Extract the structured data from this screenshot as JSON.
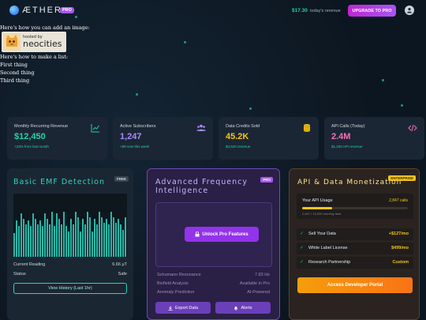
{
  "brand": {
    "name": "ÆTHER",
    "badge": "PRO"
  },
  "header": {
    "revenue_amount": "$17.30",
    "revenue_label": "today's revenue",
    "upgrade_label": "UPGRADE TO PRO"
  },
  "injected": {
    "image_intro": "Here's how you can add an image:",
    "neocities_small": "hosted by",
    "neocities_big": "neocities",
    "list_intro": "Here's how to make a list:",
    "items": [
      "First thing",
      "Second thing",
      "Third thing"
    ]
  },
  "stats": [
    {
      "title": "Monthly Recurring Revenue",
      "value": "$12,450",
      "sub": "+23% from last month",
      "icon": "chart-icon",
      "color": "#22d3a6"
    },
    {
      "title": "Active Subscribers",
      "value": "1,247",
      "sub": "+89 new this week",
      "icon": "users-icon",
      "color": "#a78bfa"
    },
    {
      "title": "Data Credits Sold",
      "value": "45.2K",
      "sub": "$4,520 revenue",
      "icon": "database-icon",
      "color": "#f5c518"
    },
    {
      "title": "API Calls (Today)",
      "value": "2.4M",
      "sub": "$1,200 API revenue",
      "icon": "code-icon",
      "color": "#f472b6"
    }
  ],
  "emf": {
    "title": "Basic EMF Detection",
    "tag": "FREE",
    "current_label": "Current Reading",
    "current_value": "6.66 μT",
    "status_label": "Status",
    "status_value": "Safe",
    "history_label": "View History (Last 1hr)"
  },
  "freq": {
    "title": "Advanced Frequency Intelligence",
    "tag": "PRO",
    "unlock_label": "Unlock Pro Features",
    "rows": [
      {
        "label": "Schumann Resonance",
        "value": "7.83 Hz"
      },
      {
        "label": "Biofield Analysis",
        "value": "Available in Pro"
      },
      {
        "label": "Anomaly Prediction",
        "value": "AI-Powered"
      }
    ],
    "export_label": "Export Data",
    "alerts_label": "Alerts"
  },
  "api": {
    "title": "API & Data Monetization",
    "tag": "ENTERPRISE",
    "usage_label": "Your API Usage",
    "usage_value": "2,847 calls",
    "usage_sub": "2,847 / 10,000 monthly limit",
    "usage_fraction": 0.2847,
    "income": [
      {
        "label": "Sell Your Data",
        "value": "+$127/mo"
      },
      {
        "label": "White Label License",
        "value": "$499/mo"
      },
      {
        "label": "Research Partnership",
        "value": "Custom"
      }
    ],
    "portal_label": "Access Developer Portal"
  }
}
